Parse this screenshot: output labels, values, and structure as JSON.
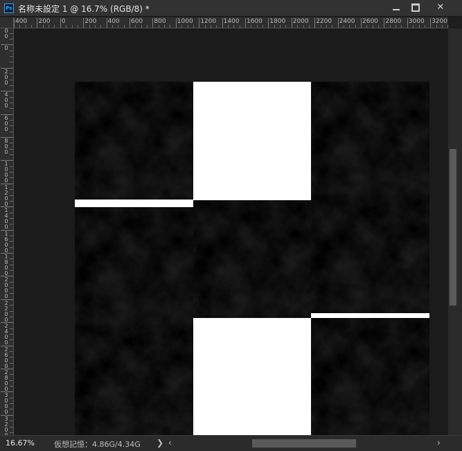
{
  "window": {
    "app_icon": "ps-icon",
    "app_icon_text": "Ps",
    "title": "名称未設定 1 @ 16.7% (RGB/8) *",
    "minimize_icon": "minimize-icon",
    "maximize_icon": "maximize-icon",
    "close_icon": "close-icon",
    "close_glyph": "✕"
  },
  "rulers": {
    "horizontal_labels": [
      "400",
      "200",
      "0",
      "200",
      "400",
      "600",
      "800",
      "1000",
      "1200",
      "1400",
      "1600",
      "1800",
      "2000",
      "2200",
      "2400",
      "2600",
      "2800",
      "3000",
      "3200"
    ],
    "vertical_labels": [
      "200",
      "0",
      "200",
      "400",
      "600",
      "800",
      "1000",
      "1200",
      "1400",
      "1600",
      "1800",
      "2000",
      "2200",
      "2400",
      "2600",
      "2800",
      "3000",
      "3200"
    ]
  },
  "canvas": {
    "background_color": "#1b1b1b",
    "document_color": "#ffffff",
    "tiles": [
      {
        "name": "clouds-tile-r1c1",
        "pattern": "clouds"
      },
      {
        "name": "clouds-tile-r1c3",
        "pattern": "clouds"
      },
      {
        "name": "clouds-tile-r2c1",
        "pattern": "clouds"
      },
      {
        "name": "clouds-tile-r2c2",
        "pattern": "clouds"
      },
      {
        "name": "clouds-tile-r2c3",
        "pattern": "clouds"
      },
      {
        "name": "clouds-tile-r3c1",
        "pattern": "clouds"
      },
      {
        "name": "clouds-tile-r3c3",
        "pattern": "clouds"
      }
    ]
  },
  "status": {
    "zoom": "16.67%",
    "doc_info": "仮想記憶：4.86G/4.34G",
    "expand_arrow": "❯",
    "scroll_left_arrow": "‹",
    "scroll_right_arrow": "›"
  }
}
